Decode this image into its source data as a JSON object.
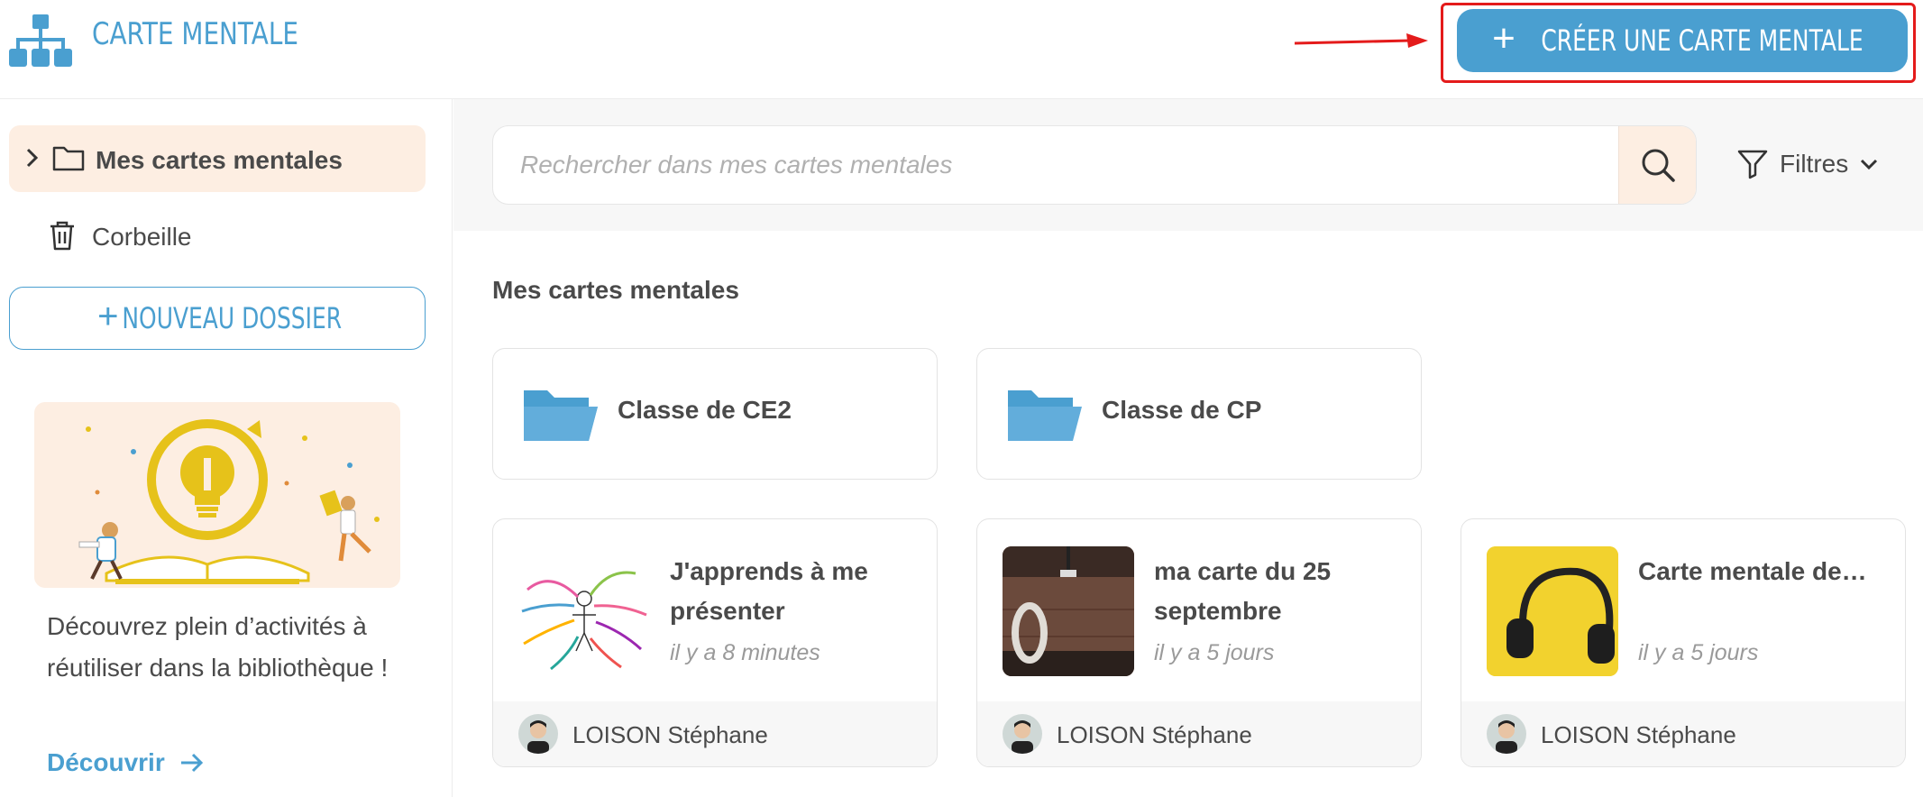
{
  "header": {
    "app_title": "CARTE MENTALE",
    "create_button": "CRÉER UNE CARTE MENTALE",
    "colors": {
      "accent": "#4a9fd0",
      "highlight_frame": "#e41b1b",
      "annotation_arrow": "#e41b1b"
    }
  },
  "sidebar": {
    "items": [
      {
        "label": "Mes cartes mentales",
        "icon": "folder-outline-icon",
        "active": true
      },
      {
        "label": "Corbeille",
        "icon": "trash-icon",
        "active": false
      }
    ],
    "new_folder_button": "NOUVEAU DOSSIER",
    "promo": {
      "text": "Découvrez plein d’activités à réutiliser dans la bibliothèque !",
      "link": "Découvrir"
    }
  },
  "main": {
    "search": {
      "placeholder": "Rechercher dans mes cartes mentales"
    },
    "filters_label": "Filtres",
    "section_title": "Mes cartes mentales",
    "folders": [
      {
        "name": "Classe de CE2"
      },
      {
        "name": "Classe de CP"
      }
    ],
    "maps": [
      {
        "title": "J'apprends à me présenter",
        "date": "il y a 8 minutes",
        "owner": "LOISON Stéphane",
        "thumb": "mindmap-sketch"
      },
      {
        "title": "ma carte du 25 septembre",
        "date": "il y a 5 jours",
        "owner": "LOISON Stéphane",
        "thumb": "wooden-wall-zero"
      },
      {
        "title": "Carte mentale de…",
        "date": "il y a 5 jours",
        "owner": "LOISON Stéphane",
        "thumb": "headphones-yellow"
      }
    ]
  }
}
